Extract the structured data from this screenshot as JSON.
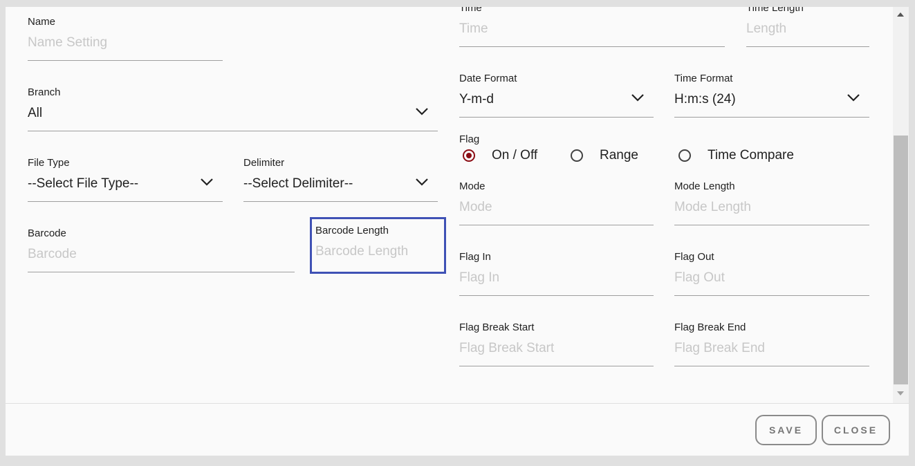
{
  "form": {
    "name": {
      "label": "Name",
      "placeholder": "Name Setting"
    },
    "branch": {
      "label": "Branch",
      "value": "All"
    },
    "file_type": {
      "label": "File Type",
      "value": "--Select File Type--"
    },
    "delimiter": {
      "label": "Delimiter",
      "value": "--Select Delimiter--"
    },
    "barcode": {
      "label": "Barcode",
      "placeholder": "Barcode"
    },
    "barcode_length": {
      "label": "Barcode Length",
      "placeholder": "Barcode Length"
    },
    "time": {
      "label": "Time",
      "placeholder": "Time"
    },
    "time_length": {
      "label": "Time Length",
      "placeholder": "Length"
    },
    "date_format": {
      "label": "Date Format",
      "value": "Y-m-d"
    },
    "time_format": {
      "label": "Time Format",
      "value": "H:m:s (24)"
    },
    "flag": {
      "label": "Flag",
      "options": [
        "On / Off",
        "Range",
        "Time Compare"
      ],
      "selected": "On / Off"
    },
    "mode": {
      "label": "Mode",
      "placeholder": "Mode"
    },
    "mode_length": {
      "label": "Mode Length",
      "placeholder": "Mode Length"
    },
    "flag_in": {
      "label": "Flag In",
      "placeholder": "Flag In"
    },
    "flag_out": {
      "label": "Flag Out",
      "placeholder": "Flag Out"
    },
    "flag_break_start": {
      "label": "Flag Break Start",
      "placeholder": "Flag Break Start"
    },
    "flag_break_end": {
      "label": "Flag Break End",
      "placeholder": "Flag Break End"
    }
  },
  "footer": {
    "save_label": "SAVE",
    "close_label": "CLOSE"
  },
  "colors": {
    "focus_border": "#3f51b5",
    "radio_selected": "#8b0d14",
    "placeholder": "#c7c7c7"
  },
  "icons": {
    "select_arrow": "chevron-down-icon",
    "scroll_up": "scroll-up-arrow-icon",
    "scroll_down": "scroll-down-arrow-icon"
  }
}
